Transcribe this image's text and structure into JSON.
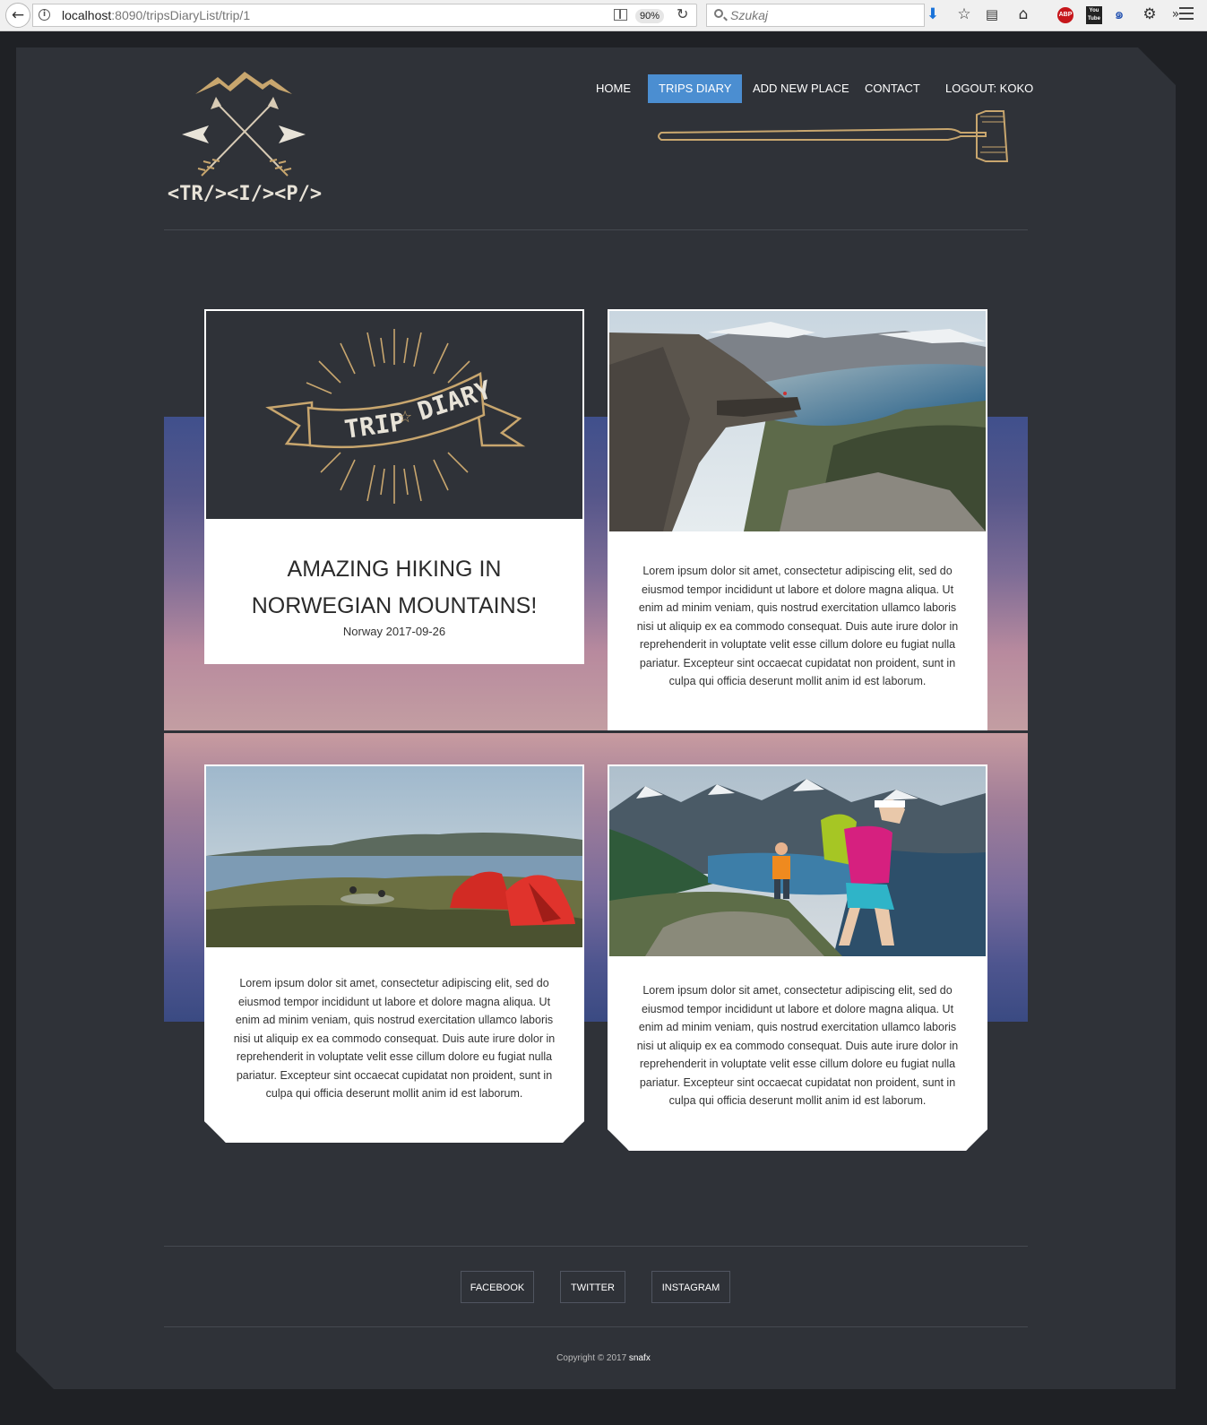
{
  "browser": {
    "url_host": "localhost",
    "url_rest": ":8090/tripsDiaryList/trip/1",
    "zoom": "90%",
    "search_placeholder": "Szukaj",
    "abp_label": "ABP",
    "youtube_label": "You Tube"
  },
  "header": {
    "logo_text": "<TR/><I/><P/>",
    "nav": {
      "home": "HOME",
      "trips_diary": "TRIPS DIARY",
      "add_new_place": "ADD NEW PLACE",
      "contact": "CONTACT",
      "logout": "LOGOUT: KOKO"
    }
  },
  "trip": {
    "badge_word_1": "TRIP",
    "badge_word_2": "DIARY",
    "title": "AMAZING HIKING IN NORWEGIAN MOUNTAINS!",
    "subtitle": "Norway 2017-09-26",
    "entries": [
      {
        "text": "Lorem ipsum dolor sit amet, consectetur adipiscing elit, sed do eiusmod tempor incididunt ut labore et dolore magna aliqua. Ut enim ad minim veniam, quis nostrud exercitation ullamco laboris nisi ut aliquip ex ea commodo consequat. Duis aute irure dolor in reprehenderit in voluptate velit esse cillum dolore eu fugiat nulla pariatur. Excepteur sint occaecat cupidatat non proident, sunt in culpa qui officia deserunt mollit anim id est laborum."
      },
      {
        "text": "Lorem ipsum dolor sit amet, consectetur adipiscing elit, sed do eiusmod tempor incididunt ut labore et dolore magna aliqua. Ut enim ad minim veniam, quis nostrud exercitation ullamco laboris nisi ut aliquip ex ea commodo consequat. Duis aute irure dolor in reprehenderit in voluptate velit esse cillum dolore eu fugiat nulla pariatur. Excepteur sint occaecat cupidatat non proident, sunt in culpa qui officia deserunt mollit anim id est laborum."
      },
      {
        "text": "Lorem ipsum dolor sit amet, consectetur adipiscing elit, sed do eiusmod tempor incididunt ut labore et dolore magna aliqua. Ut enim ad minim veniam, quis nostrud exercitation ullamco laboris nisi ut aliquip ex ea commodo consequat. Duis aute irure dolor in reprehenderit in voluptate velit esse cillum dolore eu fugiat nulla pariatur. Excepteur sint occaecat cupidatat non proident, sunt in culpa qui officia deserunt mollit anim id est laborum."
      }
    ]
  },
  "footer": {
    "facebook": "FACEBOOK",
    "twitter": "TWITTER",
    "instagram": "INSTAGRAM",
    "copyright": "Copyright © 2017",
    "author": "snafx"
  },
  "colors": {
    "accent": "#4b8ed1",
    "page_bg": "#2f3238",
    "gold": "#c8a66e"
  }
}
